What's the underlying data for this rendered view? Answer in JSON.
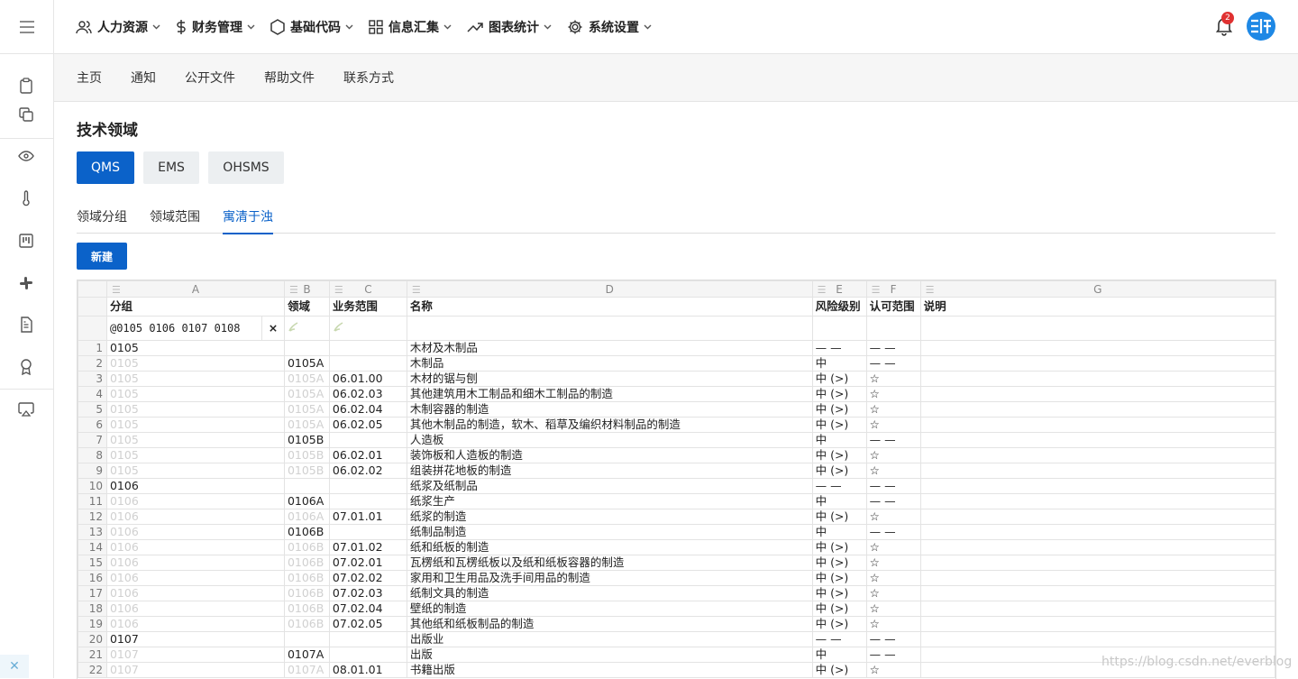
{
  "nav": {
    "menus": [
      "人力资源",
      "财务管理",
      "基础代码",
      "信息汇集",
      "图表统计",
      "系统设置"
    ],
    "notification_count": "2",
    "avatar_text": "SII"
  },
  "subnav": [
    "主页",
    "通知",
    "公开文件",
    "帮助文件",
    "联系方式"
  ],
  "page": {
    "title": "技术领域",
    "domain_buttons": [
      "QMS",
      "EMS",
      "OHSMS"
    ],
    "tabs": [
      "领域分组",
      "领域范围",
      "寓清于浊"
    ],
    "new_button": "新建"
  },
  "grid": {
    "col_letters": [
      "A",
      "B",
      "C",
      "D",
      "E",
      "F",
      "G"
    ],
    "headers": [
      "分组",
      "领域",
      "业务范围",
      "名称",
      "风险级别",
      "认可范围",
      "说明"
    ],
    "filter_text": "@0105 0106 0107 0108",
    "filter_clear": "×",
    "rows": [
      {
        "n": "1",
        "a": "0105",
        "b": "",
        "c": "",
        "d": "木材及木制品",
        "e": "— —",
        "f": "— —"
      },
      {
        "n": "2",
        "a": "0105",
        "b": "0105A",
        "c": "",
        "d": "木制品",
        "e": "中",
        "f": "— —"
      },
      {
        "n": "3",
        "a": "0105",
        "b": "0105A",
        "c": "06.01.00",
        "d": "木材的锯与刨",
        "e": "中 (>)",
        "f": "☆"
      },
      {
        "n": "4",
        "a": "0105",
        "b": "0105A",
        "c": "06.02.03",
        "d": "其他建筑用木工制品和细木工制品的制造",
        "e": "中 (>)",
        "f": "☆"
      },
      {
        "n": "5",
        "a": "0105",
        "b": "0105A",
        "c": "06.02.04",
        "d": "木制容器的制造",
        "e": "中 (>)",
        "f": "☆"
      },
      {
        "n": "6",
        "a": "0105",
        "b": "0105A",
        "c": "06.02.05",
        "d": "其他木制品的制造，软木、稻草及编织材料制品的制造",
        "e": "中 (>)",
        "f": "☆"
      },
      {
        "n": "7",
        "a": "0105",
        "b": "0105B",
        "c": "",
        "d": "人造板",
        "e": "中",
        "f": "— —"
      },
      {
        "n": "8",
        "a": "0105",
        "b": "0105B",
        "c": "06.02.01",
        "d": "装饰板和人造板的制造",
        "e": "中 (>)",
        "f": "☆"
      },
      {
        "n": "9",
        "a": "0105",
        "b": "0105B",
        "c": "06.02.02",
        "d": "组装拼花地板的制造",
        "e": "中 (>)",
        "f": "☆"
      },
      {
        "n": "10",
        "a": "0106",
        "b": "",
        "c": "",
        "d": "纸浆及纸制品",
        "e": "— —",
        "f": "— —"
      },
      {
        "n": "11",
        "a": "0106",
        "b": "0106A",
        "c": "",
        "d": "纸浆生产",
        "e": "中",
        "f": "— —"
      },
      {
        "n": "12",
        "a": "0106",
        "b": "0106A",
        "c": "07.01.01",
        "d": "纸浆的制造",
        "e": "中 (>)",
        "f": "☆"
      },
      {
        "n": "13",
        "a": "0106",
        "b": "0106B",
        "c": "",
        "d": "纸制品制造",
        "e": "中",
        "f": "— —"
      },
      {
        "n": "14",
        "a": "0106",
        "b": "0106B",
        "c": "07.01.02",
        "d": "纸和纸板的制造",
        "e": "中 (>)",
        "f": "☆"
      },
      {
        "n": "15",
        "a": "0106",
        "b": "0106B",
        "c": "07.02.01",
        "d": "瓦楞纸和瓦楞纸板以及纸和纸板容器的制造",
        "e": "中 (>)",
        "f": "☆"
      },
      {
        "n": "16",
        "a": "0106",
        "b": "0106B",
        "c": "07.02.02",
        "d": "家用和卫生用品及洗手间用品的制造",
        "e": "中 (>)",
        "f": "☆"
      },
      {
        "n": "17",
        "a": "0106",
        "b": "0106B",
        "c": "07.02.03",
        "d": "纸制文具的制造",
        "e": "中 (>)",
        "f": "☆"
      },
      {
        "n": "18",
        "a": "0106",
        "b": "0106B",
        "c": "07.02.04",
        "d": "壁纸的制造",
        "e": "中 (>)",
        "f": "☆"
      },
      {
        "n": "19",
        "a": "0106",
        "b": "0106B",
        "c": "07.02.05",
        "d": "其他纸和纸板制品的制造",
        "e": "中 (>)",
        "f": "☆"
      },
      {
        "n": "20",
        "a": "0107",
        "b": "",
        "c": "",
        "d": "出版业",
        "e": "— —",
        "f": "— —"
      },
      {
        "n": "21",
        "a": "0107",
        "b": "0107A",
        "c": "",
        "d": "出版",
        "e": "中",
        "f": "— —"
      },
      {
        "n": "22",
        "a": "0107",
        "b": "0107A",
        "c": "08.01.01",
        "d": "书籍出版",
        "e": "中 (>)",
        "f": "☆"
      }
    ]
  },
  "watermark": "https://blog.csdn.net/everblog"
}
